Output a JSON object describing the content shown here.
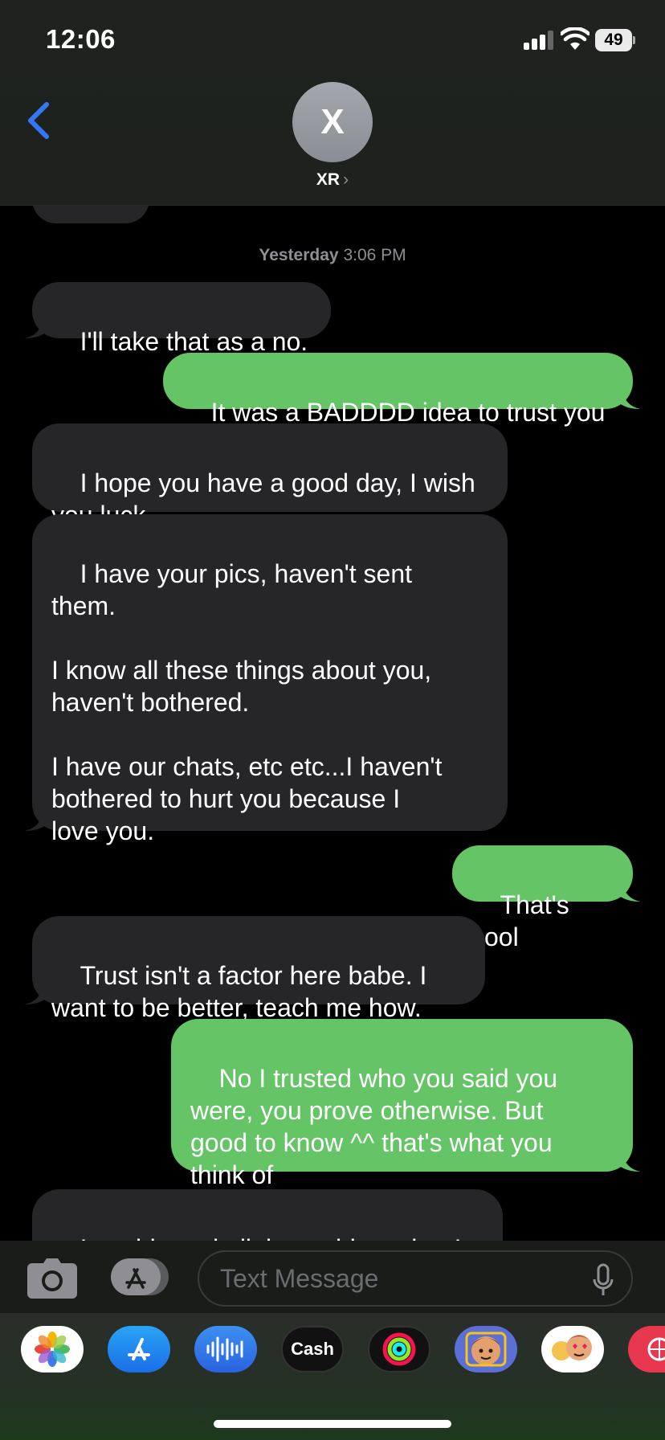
{
  "status_bar": {
    "time": "12:06",
    "battery": "49"
  },
  "header": {
    "avatar_initial": "X",
    "contact_name": "XR",
    "contact_chevron": "›"
  },
  "thread": {
    "timestamp_day": "Yesterday",
    "timestamp_time": "3:06 PM",
    "messages": [
      {
        "direction": "incoming",
        "text": "I'll take that as a no."
      },
      {
        "direction": "outgoing",
        "text": "It was a BADDDD idea to trust you"
      },
      {
        "direction": "incoming",
        "text": "I hope you have a good day, I wish\nyou luck."
      },
      {
        "direction": "incoming",
        "text": "I have your pics, haven't sent\nthem.\n\nI know all these things about you,\nhaven't bothered.\n\nI have our chats, etc etc...I haven't\nbothered to hurt you because I\nlove you."
      },
      {
        "direction": "outgoing",
        "text": "That's cool"
      },
      {
        "direction": "incoming",
        "text": "Trust isn't a factor here babe. I\nwant to be better, teach me how."
      },
      {
        "direction": "outgoing",
        "text": "No I trusted who you said you\nwere, you prove otherwise. But\ngood to know ^^ that's what you\nthink of"
      },
      {
        "direction": "incoming",
        "text": "I could send all those things, but I\ndon't and never do"
      }
    ]
  },
  "input": {
    "placeholder": "Text Message"
  },
  "drawer": {
    "apps": [
      {
        "name": "photos-app-icon"
      },
      {
        "name": "app-store-icon"
      },
      {
        "name": "audio-message-icon"
      },
      {
        "name": "apple-cash-icon",
        "label": "Cash"
      },
      {
        "name": "activity-icon"
      },
      {
        "name": "memoji-icon"
      },
      {
        "name": "memoji-stickers-icon"
      },
      {
        "name": "web-images-icon"
      }
    ]
  },
  "colors": {
    "incoming": "#262628",
    "outgoing": "#65c466",
    "accent": "#3478f6"
  }
}
